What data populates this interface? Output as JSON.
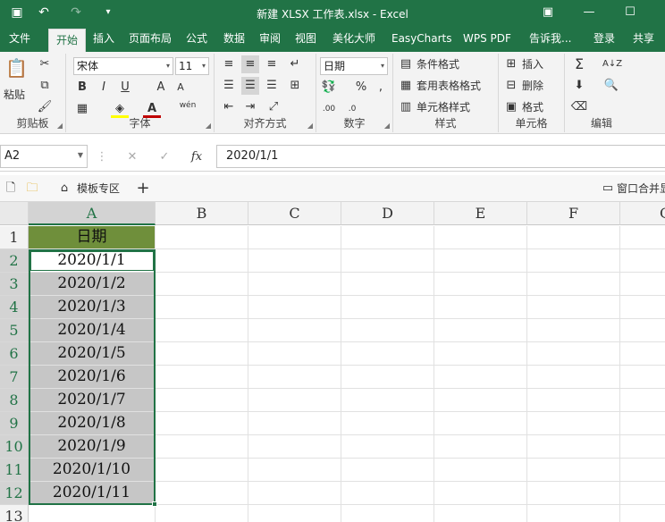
{
  "title": "新建 XLSX 工作表.xlsx - Excel",
  "quick_access": {
    "save": "save-icon",
    "undo": "undo-icon",
    "redo": "redo-icon",
    "customize": "customize-icon"
  },
  "tabs": [
    "文件",
    "开始",
    "插入",
    "页面布局",
    "公式",
    "数据",
    "审阅",
    "视图",
    "美化大师",
    "EasyCharts",
    "WPS PDF",
    "告诉我...",
    "登录",
    "共享"
  ],
  "ribbon": {
    "clipboard": {
      "paste": "粘贴",
      "label": "剪贴板"
    },
    "font": {
      "name": "宋体",
      "size": "11",
      "bold": "B",
      "italic": "I",
      "underline": "U",
      "grow": "A",
      "shrink": "A",
      "wen": "wén",
      "label": "字体"
    },
    "align": {
      "label": "对齐方式"
    },
    "number": {
      "format": "日期",
      "label": "数字",
      "pct": "%"
    },
    "styles": {
      "cond": "条件格式",
      "table": "套用表格格式",
      "cell": "单元格样式",
      "label": "样式"
    },
    "cells": {
      "insert": "插入",
      "delete": "删除",
      "format": "格式",
      "label": "单元格"
    },
    "edit": {
      "label": "编辑"
    }
  },
  "formula_bar": {
    "name_box": "A2",
    "fx": "fx",
    "formula": "2020/1/1"
  },
  "wps_bar": {
    "template": "模板专区",
    "add": "+",
    "window": "窗口合并显"
  },
  "columns": [
    "A",
    "B",
    "C",
    "D",
    "E",
    "F",
    "G"
  ],
  "rows": [
    "1",
    "2",
    "3",
    "4",
    "5",
    "6",
    "7",
    "8",
    "9",
    "10",
    "11",
    "12",
    "13"
  ],
  "cells_a": [
    "日期",
    "2020/1/1",
    "2020/1/2",
    "2020/1/3",
    "2020/1/4",
    "2020/1/5",
    "2020/1/6",
    "2020/1/7",
    "2020/1/8",
    "2020/1/9",
    "2020/1/10",
    "2020/1/11",
    ""
  ],
  "colors": {
    "header_fill": "#6f8f3b",
    "selection_fill": "#c6c6c6",
    "accent": "#217346"
  }
}
